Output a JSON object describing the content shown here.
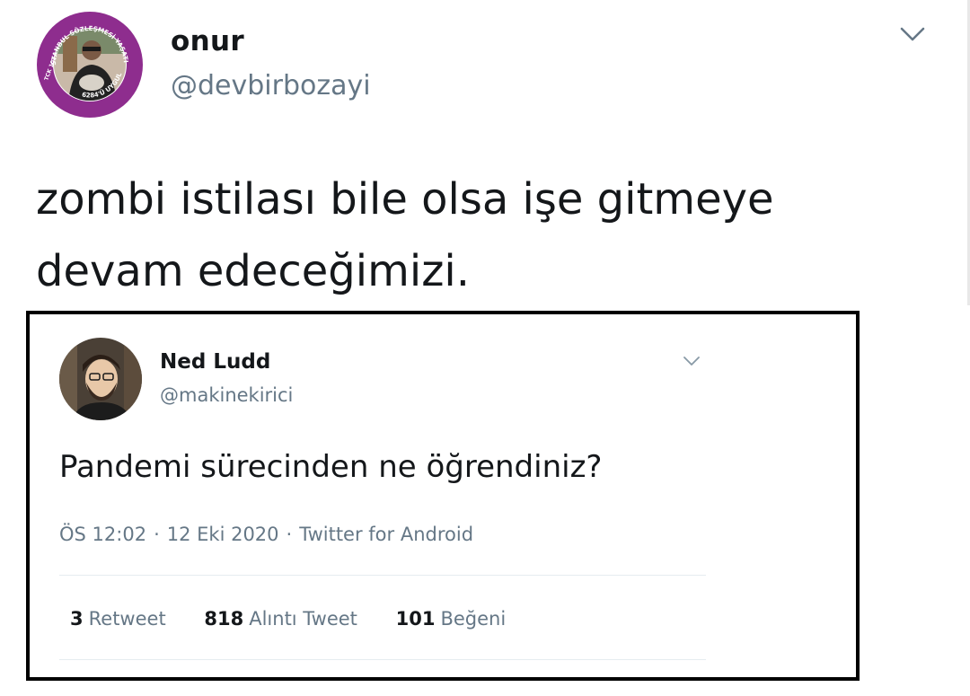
{
  "outer_tweet": {
    "author_name": "onur",
    "author_handle": "@devbirbozayi",
    "avatar_icon": "profile-photo-with-purple-badge-ring",
    "badge_ring_text_top": "İSTANBUL SÖZLEŞMESİ YAŞATIR",
    "badge_ring_text_bottom": "6284'Ü UYGULA",
    "badge_ring_text_left": "TCK 102",
    "text_line_1": "zombi istilası bile olsa işe gitmeye",
    "text_line_2": "devam edeceğimizi.",
    "menu_icon": "chevron-down-icon",
    "badge_color": "#8e2d8e"
  },
  "quoted_tweet": {
    "author_name": "Ned Ludd",
    "author_handle": "@makinekirici",
    "avatar_icon": "profile-photo-bearded-man-glasses",
    "text": "Pandemi sürecinden ne öğrendiniz?",
    "meta": {
      "time": "ÖS 12:02",
      "date": "12 Eki 2020",
      "source": "Twitter for Android",
      "separator": "·"
    },
    "stats": {
      "retweets_count": "3",
      "retweets_label": "Retweet",
      "quotes_count": "818",
      "quotes_label": "Alıntı Tweet",
      "likes_count": "101",
      "likes_label": "Beğeni"
    },
    "menu_icon": "chevron-down-icon",
    "border_color": "#000000"
  }
}
